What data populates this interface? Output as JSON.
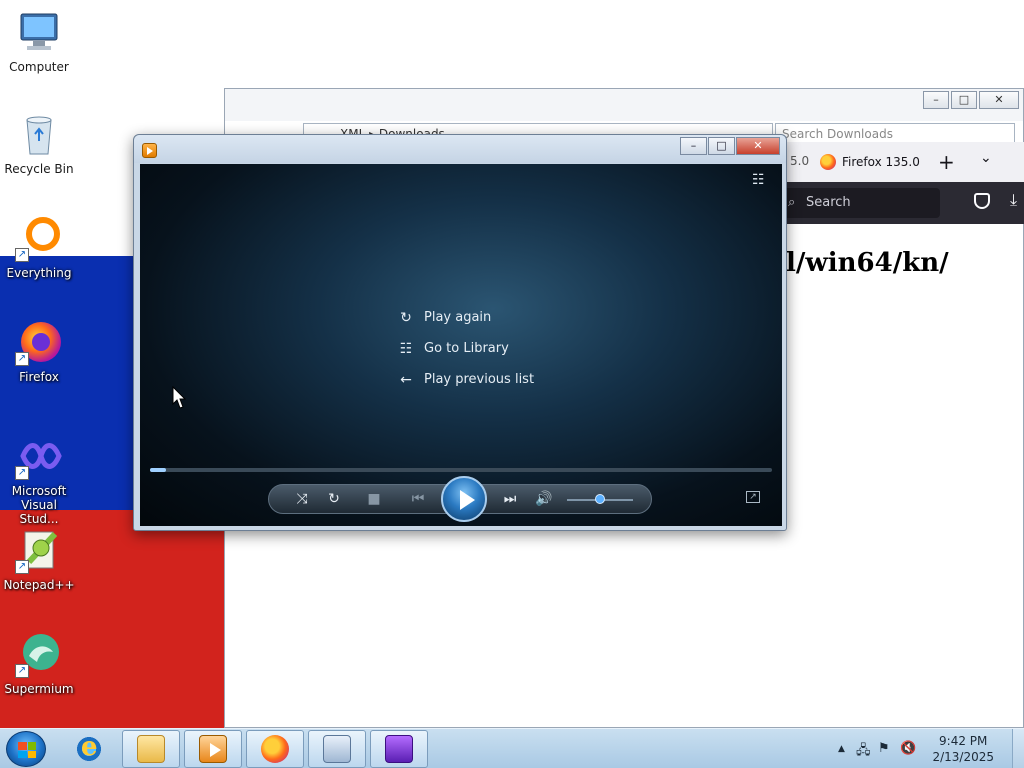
{
  "desktop": {
    "icons": [
      {
        "label": "Computer",
        "icon": "computer-icon"
      },
      {
        "label": "Recycle Bin",
        "icon": "recycle-bin-icon"
      },
      {
        "label": "Everything",
        "icon": "everything-icon"
      },
      {
        "label": "Firefox",
        "icon": "firefox-icon"
      },
      {
        "label_line1": "Microsoft",
        "label_line2": "Visual Stud...",
        "icon": "visual-studio-icon"
      },
      {
        "label": "Notepad++",
        "icon": "notepad-plus-plus-icon"
      },
      {
        "label": "Supermium",
        "icon": "supermium-icon"
      }
    ]
  },
  "explorer": {
    "address": "XML ▸ Downloads",
    "search_placeholder": "Search Downloads",
    "controls": {
      "minimize": "–",
      "maximize": "□",
      "close": "✕"
    }
  },
  "firefox": {
    "prev_tab_fragment": "5.0",
    "tab_title": "Firefox 135.0",
    "new_tab": "+",
    "list_tabs": "⌄",
    "search_placeholder": "Search",
    "page_text": "l/win64/kn/"
  },
  "media_player": {
    "controls": {
      "minimize": "–",
      "maximize": "□",
      "close": "✕"
    },
    "menu": [
      {
        "label": "Play again",
        "icon": "replay-icon",
        "glyph": "↻"
      },
      {
        "label": "Go to Library",
        "icon": "library-icon",
        "glyph": "☷"
      },
      {
        "label": "Play previous list",
        "icon": "back-arrow-icon",
        "glyph": "←"
      }
    ],
    "switch_view_glyph": "☷",
    "transport": {
      "shuffle": "⤨",
      "repeat": "↻",
      "stop": "■",
      "previous": "⏮",
      "next": "⏭",
      "mute": "🔊"
    },
    "seek_progress": 0.026,
    "volume_level": 0.5,
    "accent": "#5bb0ff"
  },
  "taskbar": {
    "apps": [
      {
        "icon": "internet-explorer-icon"
      },
      {
        "icon": "file-explorer-icon"
      },
      {
        "icon": "windows-media-player-icon"
      },
      {
        "icon": "firefox-icon"
      },
      {
        "icon": "on-screen-keyboard-icon"
      },
      {
        "icon": "app-box-icon"
      }
    ],
    "tray": {
      "show_hidden": "▲",
      "network": "🖧",
      "flag": "⚑",
      "volume": "🔇"
    },
    "clock": {
      "time": "9:42 PM",
      "date": "2/13/2025"
    }
  },
  "colors": {
    "wall_blue": "#0a2fb0",
    "wall_red": "#d2231d",
    "taskbar": "#bcd6ec"
  }
}
